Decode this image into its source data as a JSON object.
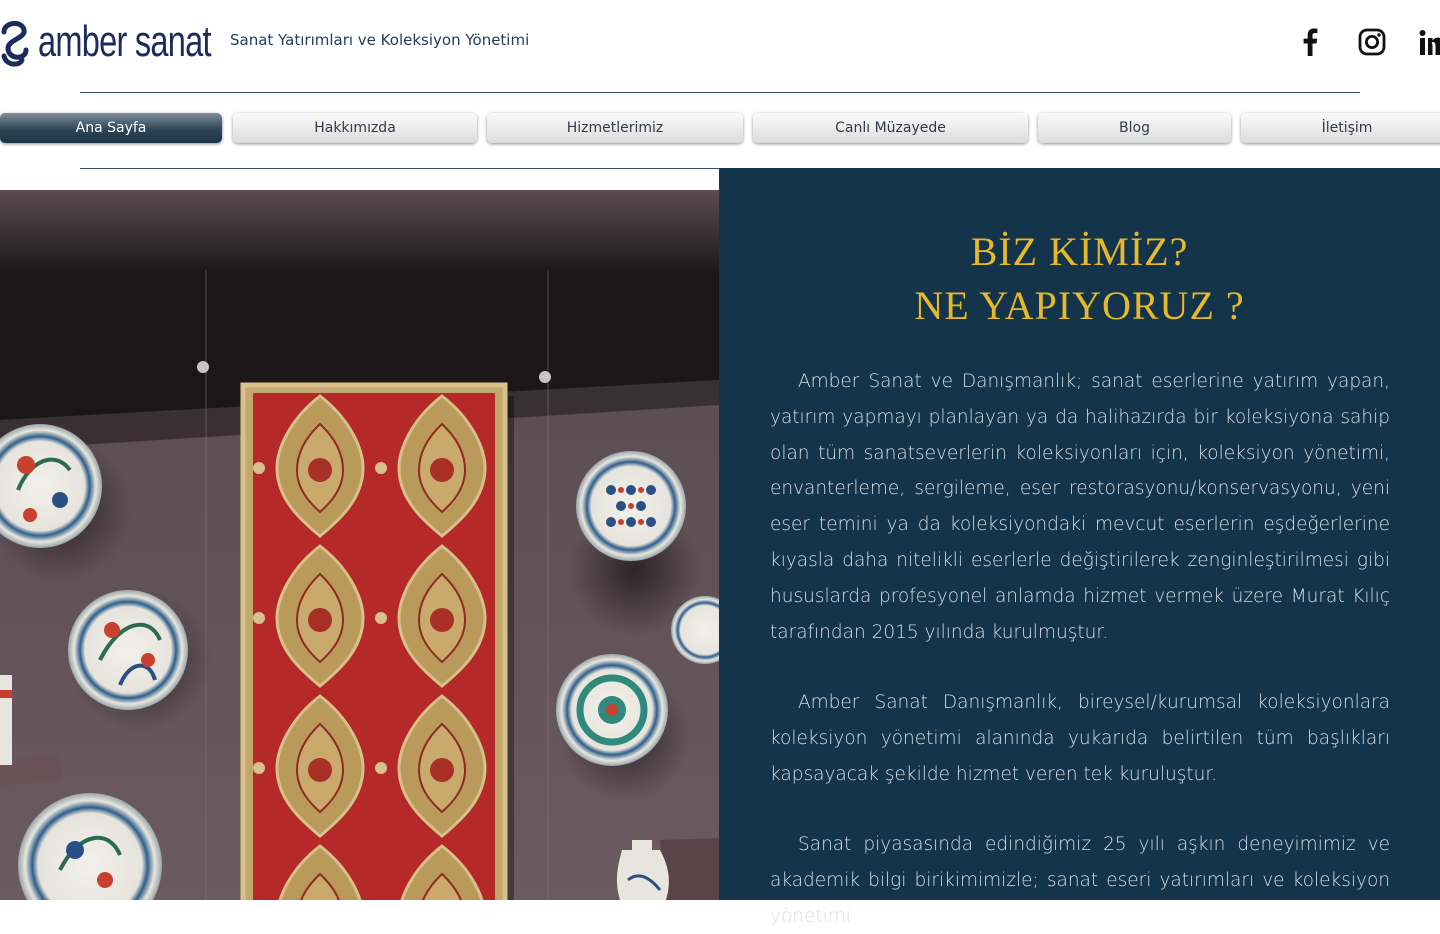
{
  "header": {
    "logo_text": "amber sanat",
    "tagline": "Sanat Yatırımları ve Koleksiyon Yönetimi",
    "social": [
      {
        "icon": "facebook-icon"
      },
      {
        "icon": "instagram-icon"
      },
      {
        "icon": "linkedin-icon"
      }
    ]
  },
  "nav": {
    "items": [
      {
        "label": "Ana Sayfa",
        "active": true
      },
      {
        "label": "Hakkımızda",
        "active": false
      },
      {
        "label": "Hizmetlerimiz",
        "active": false
      },
      {
        "label": "Canlı Müzayede",
        "active": false
      },
      {
        "label": "Blog",
        "active": false
      },
      {
        "label": "İletişim",
        "active": false
      }
    ]
  },
  "hero_image": {
    "icon": "museum-display-photo"
  },
  "about": {
    "title_line1": "BİZ KİMİZ?",
    "title_line2": "NE YAPIYORUZ ?",
    "paragraph1": "Amber Sanat ve Danışmanlık; sanat eserlerine yatırım yapan, yatırım yapmayı planlayan ya da halihazırda bir koleksiyona sahip olan tüm sanatseverlerin koleksiyonları için, koleksiyon yönetimi, envanterleme, sergileme, eser restorasyonu/konservasyonu, yeni eser temini ya da koleksiyondaki mevcut eserlerin eşdeğerlerine kıyasla daha nitelikli eserlerle değiştirilerek zenginleştirilmesi gibi hususlarda profesyonel anlamda hizmet vermek üzere Murat Kılıç tarafından 2015 yılında kurulmuştur.",
    "paragraph2": "Amber Sanat Danışmanlık, bireysel/kurumsal koleksiyonlara koleksiyon yönetimi alanında yukarıda belirtilen tüm başlıkları kapsayacak şekilde hizmet veren tek kuruluştur.",
    "paragraph3": "Sanat piyasasında edindiğimiz 25 yılı aşkın deneyimimiz ve akademik bilgi birikimimizle; sanat eseri yatırımları ve koleksiyon yönetimi"
  },
  "colors": {
    "panel_bg": "#14344b",
    "title_gold": "#e6b928",
    "logo_navy": "#1d2a5c",
    "active_nav": "#2d4656"
  }
}
